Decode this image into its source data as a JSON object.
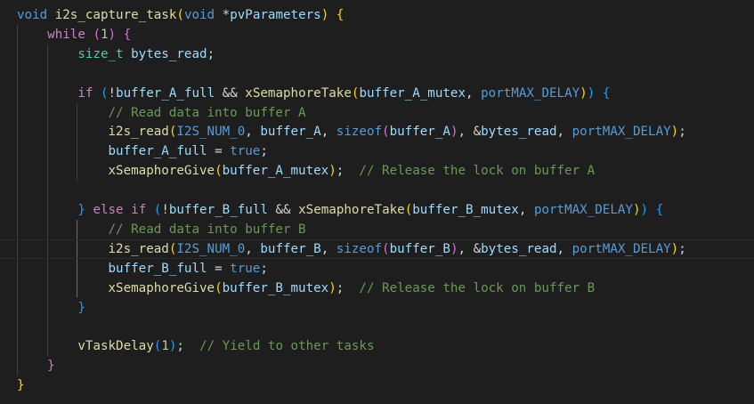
{
  "editor": {
    "lines": [
      [
        [
          "kw",
          "void"
        ],
        [
          "pun",
          " "
        ],
        [
          "fn",
          "i2s_capture_task"
        ],
        [
          "br1",
          "("
        ],
        [
          "kw",
          "void"
        ],
        [
          "pun",
          " *"
        ],
        [
          "var",
          "pvParameters"
        ],
        [
          "br1",
          ")"
        ],
        [
          "pun",
          " "
        ],
        [
          "br1",
          "{"
        ]
      ],
      [
        [
          "pun",
          "    "
        ],
        [
          "ctl",
          "while"
        ],
        [
          "pun",
          " "
        ],
        [
          "br2",
          "("
        ],
        [
          "num",
          "1"
        ],
        [
          "br2",
          ")"
        ],
        [
          "pun",
          " "
        ],
        [
          "br2",
          "{"
        ]
      ],
      [
        [
          "pun",
          "        "
        ],
        [
          "typ",
          "size_t"
        ],
        [
          "pun",
          " "
        ],
        [
          "var",
          "bytes_read"
        ],
        [
          "pun",
          ";"
        ]
      ],
      [],
      [
        [
          "pun",
          "        "
        ],
        [
          "ctl",
          "if"
        ],
        [
          "pun",
          " "
        ],
        [
          "br3",
          "("
        ],
        [
          "pun",
          "!"
        ],
        [
          "var",
          "buffer_A_full"
        ],
        [
          "pun",
          " && "
        ],
        [
          "fn",
          "xSemaphoreTake"
        ],
        [
          "br1",
          "("
        ],
        [
          "var",
          "buffer_A_mutex"
        ],
        [
          "pun",
          ", "
        ],
        [
          "mac",
          "portMAX_DELAY"
        ],
        [
          "br1",
          ")"
        ],
        [
          "br3",
          ")"
        ],
        [
          "pun",
          " "
        ],
        [
          "br3",
          "{"
        ]
      ],
      [
        [
          "pun",
          "            "
        ],
        [
          "cmt",
          "// Read data into buffer A"
        ]
      ],
      [
        [
          "pun",
          "            "
        ],
        [
          "fn",
          "i2s_read"
        ],
        [
          "br1",
          "("
        ],
        [
          "mac",
          "I2S_NUM_0"
        ],
        [
          "pun",
          ", "
        ],
        [
          "var",
          "buffer_A"
        ],
        [
          "pun",
          ", "
        ],
        [
          "kw",
          "sizeof"
        ],
        [
          "br2",
          "("
        ],
        [
          "var",
          "buffer_A"
        ],
        [
          "br2",
          ")"
        ],
        [
          "pun",
          ", &"
        ],
        [
          "var",
          "bytes_read"
        ],
        [
          "pun",
          ", "
        ],
        [
          "mac",
          "portMAX_DELAY"
        ],
        [
          "br1",
          ")"
        ],
        [
          "pun",
          ";"
        ]
      ],
      [
        [
          "pun",
          "            "
        ],
        [
          "var",
          "buffer_A_full"
        ],
        [
          "pun",
          " = "
        ],
        [
          "kw",
          "true"
        ],
        [
          "pun",
          ";"
        ]
      ],
      [
        [
          "pun",
          "            "
        ],
        [
          "fn",
          "xSemaphoreGive"
        ],
        [
          "br1",
          "("
        ],
        [
          "var",
          "buffer_A_mutex"
        ],
        [
          "br1",
          ")"
        ],
        [
          "pun",
          ";  "
        ],
        [
          "cmt",
          "// Release the lock on buffer A"
        ]
      ],
      [],
      [
        [
          "pun",
          "        "
        ],
        [
          "br3",
          "}"
        ],
        [
          "pun",
          " "
        ],
        [
          "ctl",
          "else"
        ],
        [
          "pun",
          " "
        ],
        [
          "ctl",
          "if"
        ],
        [
          "pun",
          " "
        ],
        [
          "br3",
          "("
        ],
        [
          "pun",
          "!"
        ],
        [
          "var",
          "buffer_B_full"
        ],
        [
          "pun",
          " && "
        ],
        [
          "fn",
          "xSemaphoreTake"
        ],
        [
          "br1",
          "("
        ],
        [
          "var",
          "buffer_B_mutex"
        ],
        [
          "pun",
          ", "
        ],
        [
          "mac",
          "portMAX_DELAY"
        ],
        [
          "br1",
          ")"
        ],
        [
          "br3",
          ")"
        ],
        [
          "pun",
          " "
        ],
        [
          "br3",
          "{"
        ]
      ],
      [
        [
          "pun",
          "            "
        ],
        [
          "cmt",
          "// Read data into buffer B"
        ]
      ],
      [
        [
          "pun",
          "            "
        ],
        [
          "fn",
          "i2s_read"
        ],
        [
          "br1",
          "("
        ],
        [
          "mac",
          "I2S_NUM_0"
        ],
        [
          "pun",
          ", "
        ],
        [
          "var",
          "buffer_B"
        ],
        [
          "pun",
          ", "
        ],
        [
          "kw",
          "sizeof"
        ],
        [
          "br2",
          "("
        ],
        [
          "var",
          "buffer_B"
        ],
        [
          "br2",
          ")"
        ],
        [
          "pun",
          ", &"
        ],
        [
          "var",
          "bytes_read"
        ],
        [
          "pun",
          ", "
        ],
        [
          "mac",
          "portMAX_DELAY"
        ],
        [
          "br1",
          ")"
        ],
        [
          "pun",
          ";"
        ]
      ],
      [
        [
          "pun",
          "            "
        ],
        [
          "var",
          "buffer_B_full"
        ],
        [
          "pun",
          " = "
        ],
        [
          "kw",
          "true"
        ],
        [
          "pun",
          ";"
        ]
      ],
      [
        [
          "pun",
          "            "
        ],
        [
          "fn",
          "xSemaphoreGive"
        ],
        [
          "br1",
          "("
        ],
        [
          "var",
          "buffer_B_mutex"
        ],
        [
          "br1",
          ")"
        ],
        [
          "pun",
          ";  "
        ],
        [
          "cmt",
          "// Release the lock on buffer B"
        ]
      ],
      [
        [
          "pun",
          "        "
        ],
        [
          "br3",
          "}"
        ]
      ],
      [],
      [
        [
          "pun",
          "        "
        ],
        [
          "fn",
          "vTaskDelay"
        ],
        [
          "br3",
          "("
        ],
        [
          "num",
          "1"
        ],
        [
          "br3",
          ")"
        ],
        [
          "pun",
          ";  "
        ],
        [
          "cmt",
          "// Yield to other tasks"
        ]
      ],
      [
        [
          "pun",
          "    "
        ],
        [
          "br2",
          "}"
        ]
      ],
      [
        [
          "br1",
          "}"
        ]
      ]
    ],
    "cursor_line": 12,
    "colors": {
      "background": "#1e1e1e",
      "keyword": "#569cd6",
      "control": "#c586c0",
      "function": "#dcdcaa",
      "variable": "#9cdcfe",
      "type": "#4ec9b0",
      "number": "#b5cea8",
      "comment": "#6a9955"
    }
  }
}
